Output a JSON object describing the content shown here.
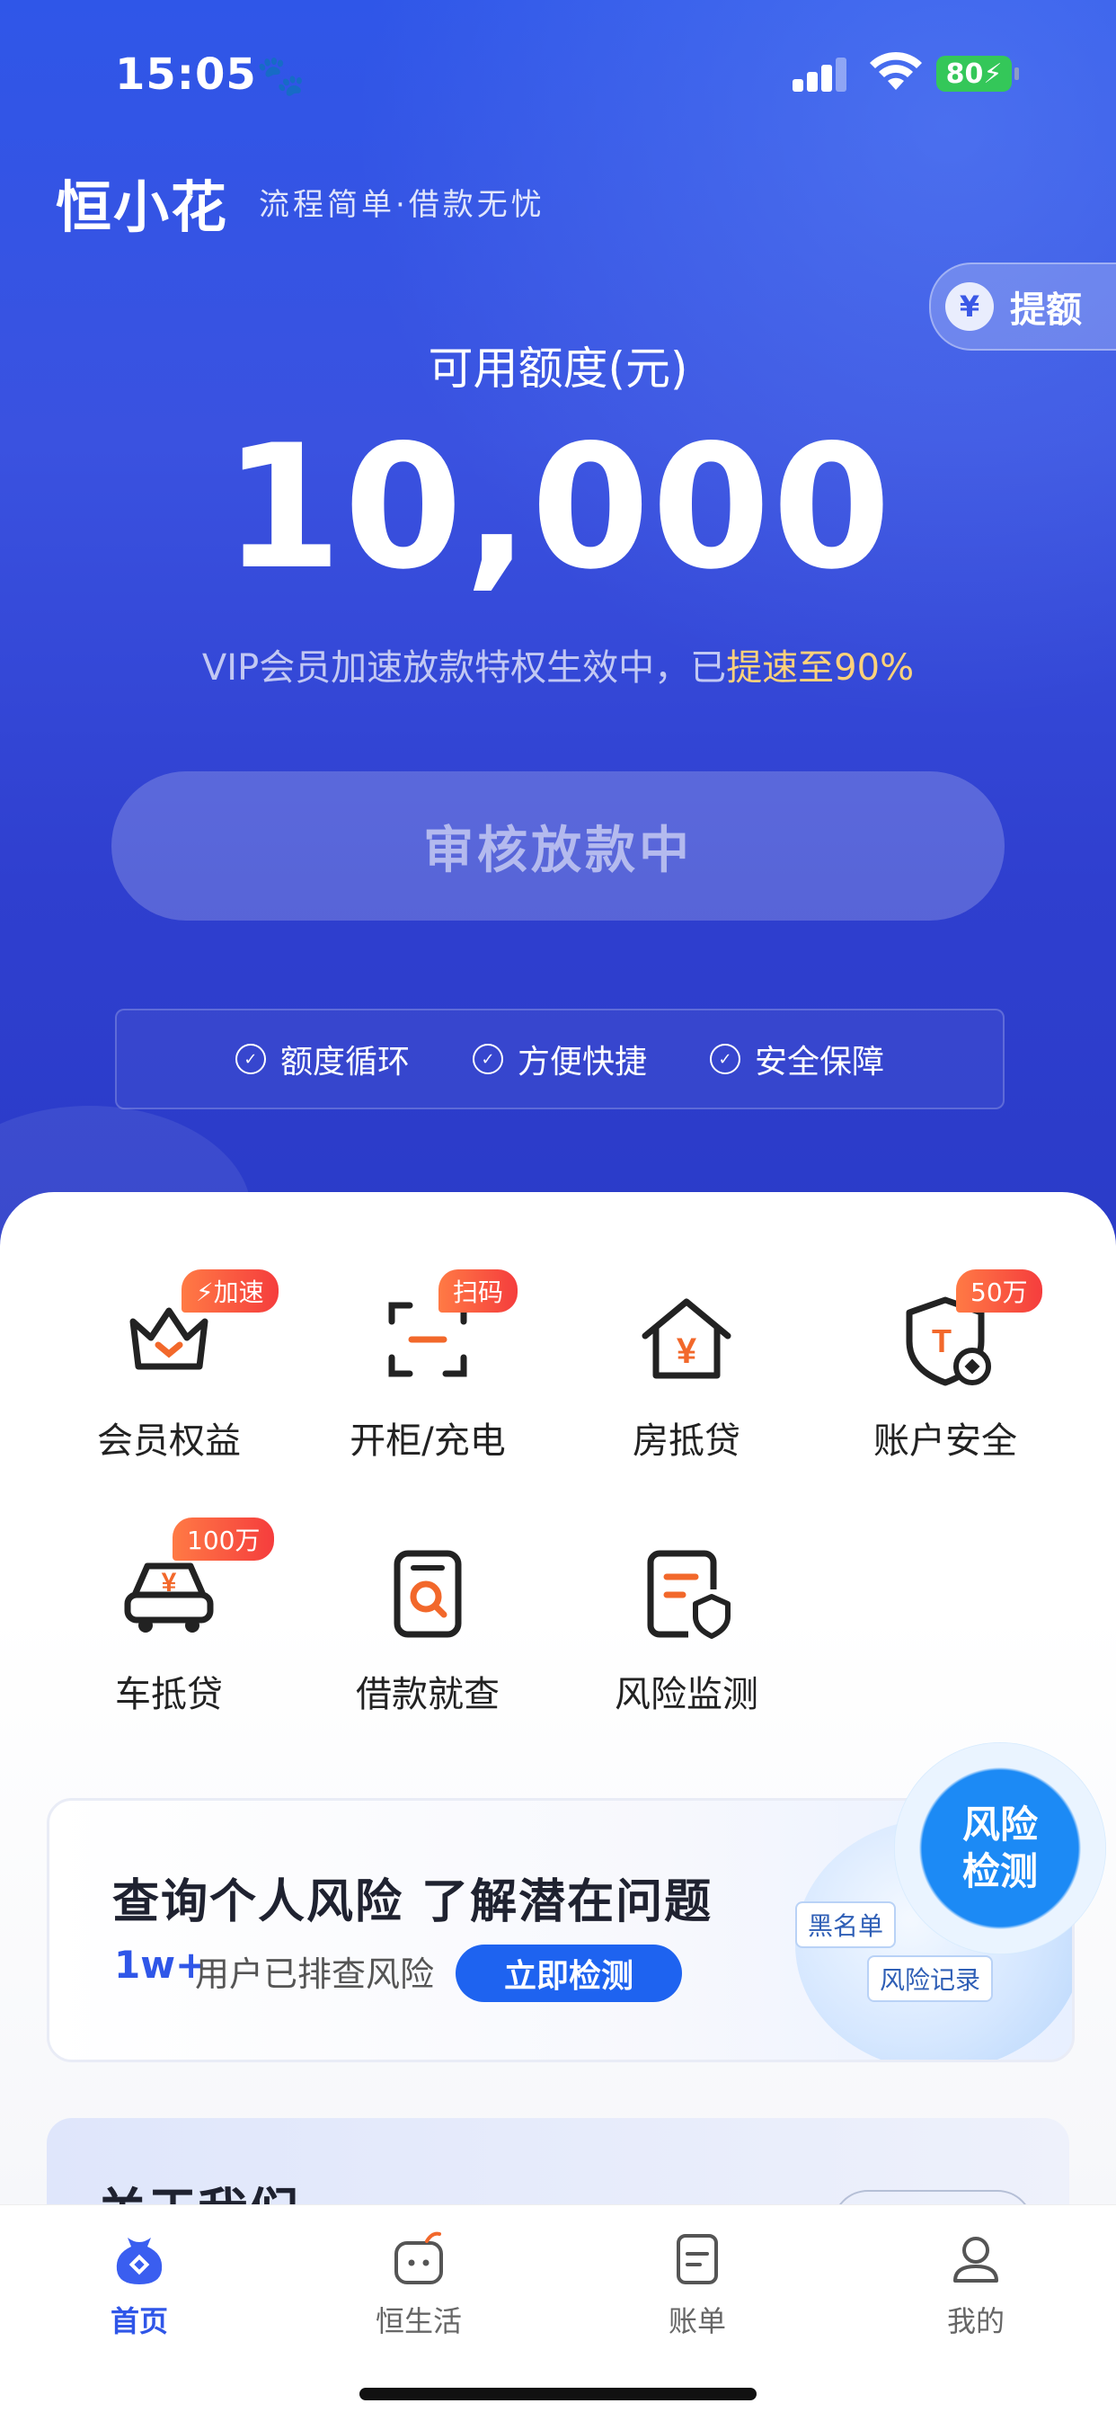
{
  "status": {
    "time": "15:05",
    "battery": "80"
  },
  "header": {
    "brand": "恒小花",
    "slogan": "流程简单·借款无忧",
    "raise_label": "提额",
    "raise_coin": "¥"
  },
  "credit": {
    "label": "可用额度(元)",
    "amount": "10,000",
    "vip_text": "VIP会员加速放款特权生效中，已",
    "vip_highlight": "提速至90%",
    "audit_button": "审核放款中"
  },
  "features": [
    "额度循环",
    "方便快捷",
    "安全保障"
  ],
  "services": [
    {
      "label": "会员权益",
      "tag": "⚡加速"
    },
    {
      "label": "开柜/充电",
      "tag": "扫码"
    },
    {
      "label": "房抵贷",
      "tag": ""
    },
    {
      "label": "账户安全",
      "tag": "50万"
    },
    {
      "label": "车抵贷",
      "tag": "100万"
    },
    {
      "label": "借款就查",
      "tag": ""
    },
    {
      "label": "风险监测",
      "tag": ""
    }
  ],
  "banner": {
    "title": "查询个人风险 了解潜在问题",
    "count": "1w+",
    "subtitle": "用户已排查风险",
    "button": "立即检测",
    "chip_blacklist": "黑名单",
    "chip_record": "风险记录",
    "circle_line1": "风险",
    "circle_line2": "检测"
  },
  "about": {
    "title": "关于我们"
  },
  "tabs": [
    {
      "label": "首页",
      "icon": "home-bag-icon"
    },
    {
      "label": "恒生活",
      "icon": "life-icon"
    },
    {
      "label": "账单",
      "icon": "bill-icon"
    },
    {
      "label": "我的",
      "icon": "profile-icon"
    }
  ],
  "colors": {
    "primary": "#2f56e8",
    "accent_orange": "#f2682b",
    "highlight": "#ffd27a"
  }
}
